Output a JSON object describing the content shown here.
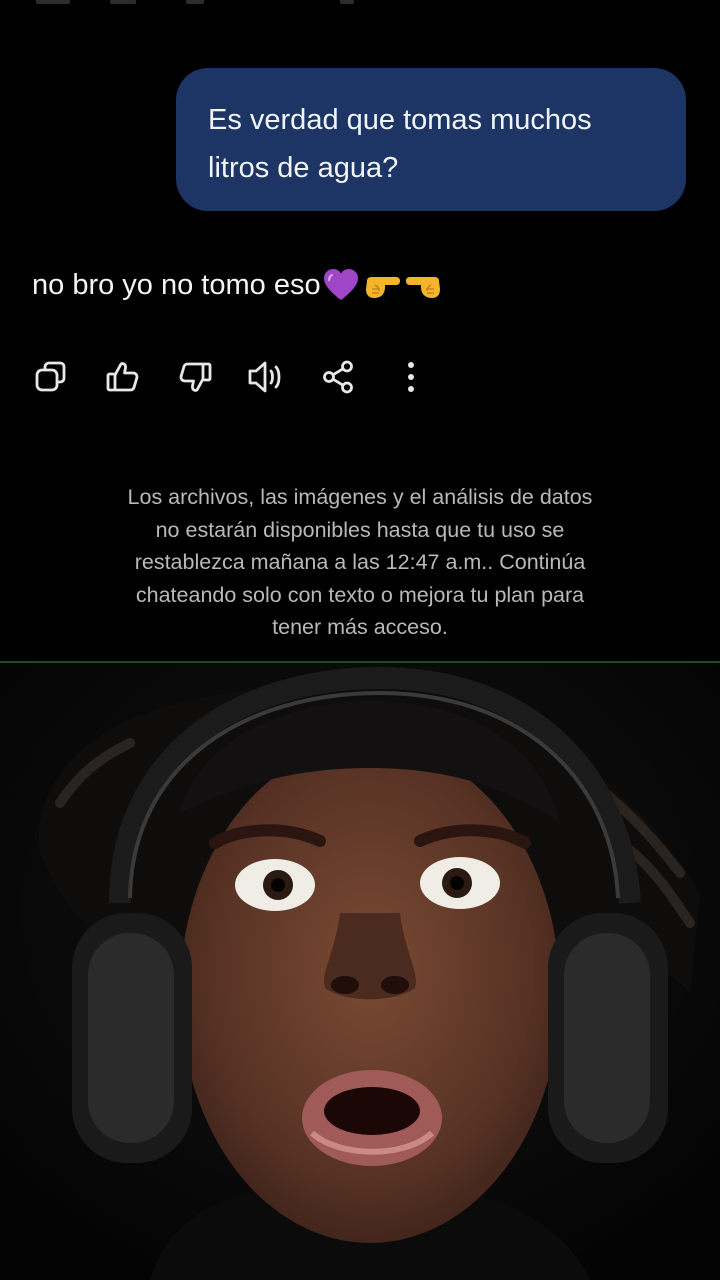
{
  "user_message": {
    "text": "Es verdad que tomas muchos\nlitros de agua?"
  },
  "reply": {
    "text": "no bro yo no tomo eso",
    "emoji": [
      "purple-heart",
      "pointing-right-hand",
      "pointing-left-hand"
    ]
  },
  "actions": [
    {
      "name": "copy",
      "icon": "copy-icon"
    },
    {
      "name": "like",
      "icon": "thumbs-up-icon"
    },
    {
      "name": "dislike",
      "icon": "thumbs-down-icon"
    },
    {
      "name": "read-aloud",
      "icon": "speaker-icon"
    },
    {
      "name": "share",
      "icon": "share-icon"
    },
    {
      "name": "more",
      "icon": "more-vertical-icon"
    }
  ],
  "notice": {
    "text": "Los archivos, las imágenes y el análisis de datos\nno estarán disponibles hasta que tu uso se\nrestablezca mañana a las 12:47 a.m.. Continúa\nchateando solo con texto o mejora tu plan para\ntener más acceso."
  },
  "colors": {
    "background": "#000000",
    "user_bubble": "#1c3564",
    "notice_text": "#b9b9b9",
    "icon": "#e8e8e8",
    "divider": "#1f4a26"
  },
  "reaction_image": {
    "subject": "surprised-man-with-headphones"
  }
}
